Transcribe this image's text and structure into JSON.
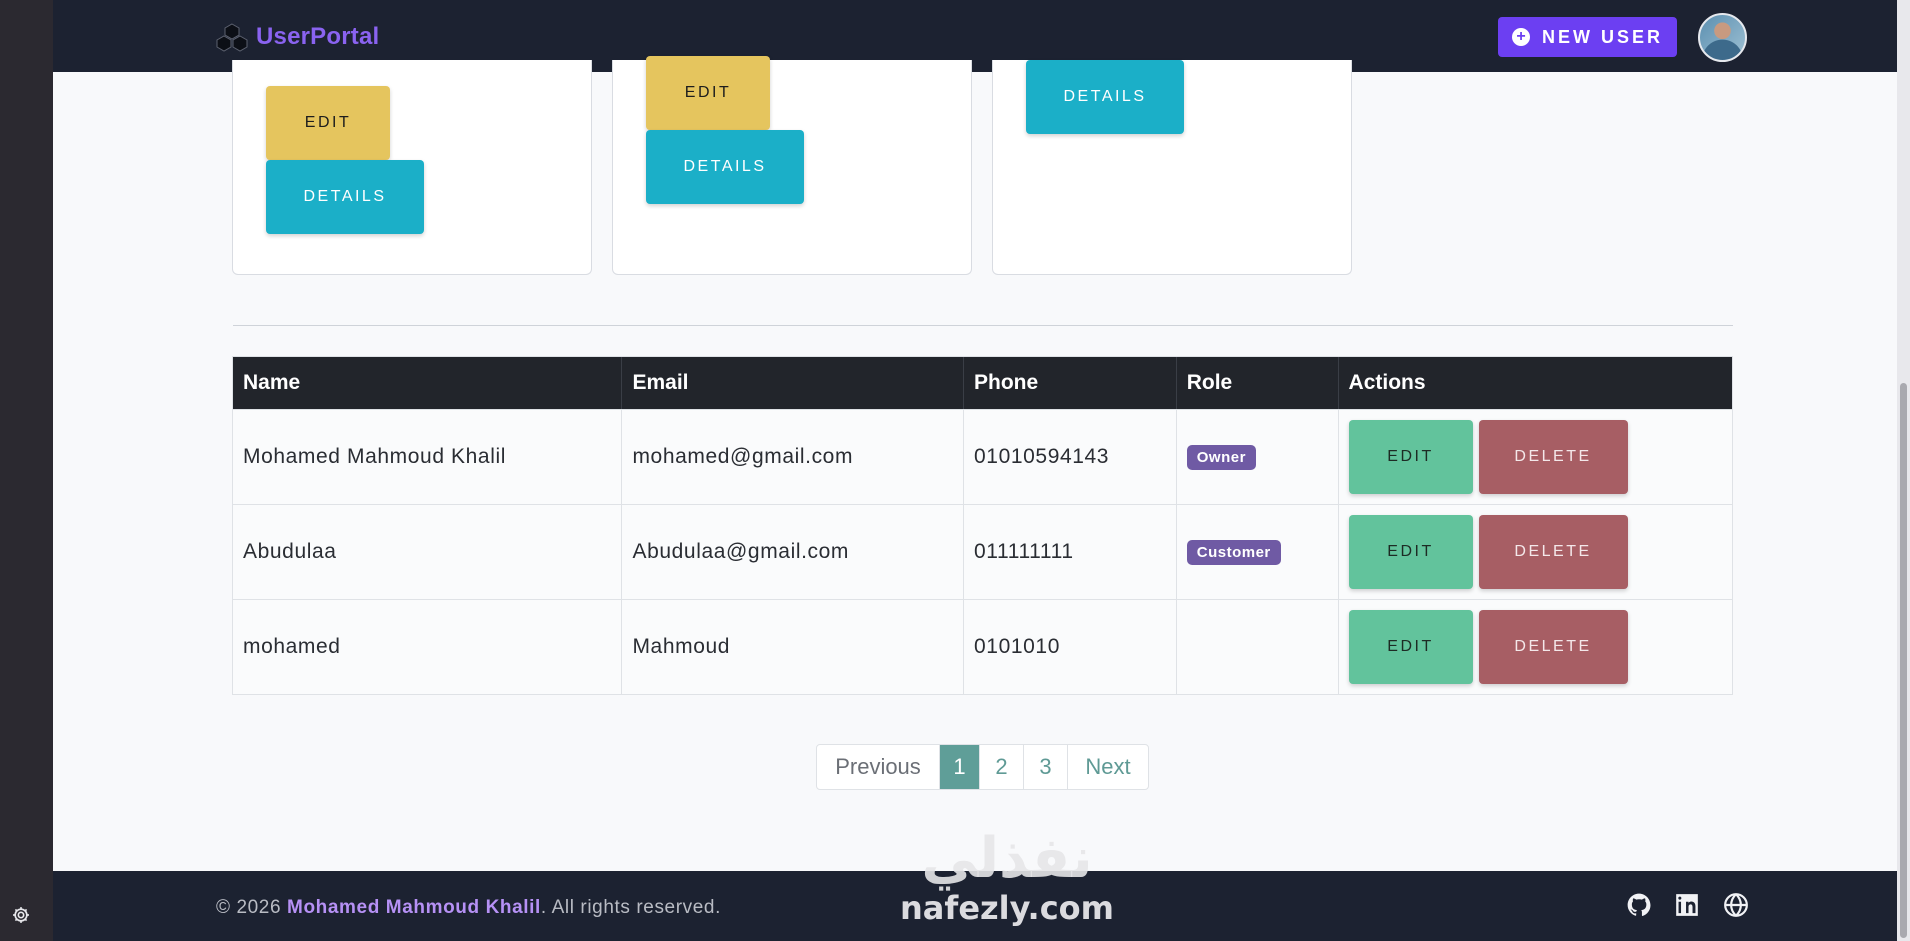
{
  "header": {
    "brand_name": "UserPortal",
    "new_user_label": "NEW USER",
    "brand_icon": "cubes-icon"
  },
  "cards": [
    {
      "edit_label": "EDIT",
      "details_label": "DETAILS"
    },
    {
      "edit_label": "EDIT",
      "details_label": "DETAILS"
    },
    {
      "details_label": "DETAILS"
    }
  ],
  "table": {
    "columns": [
      "Name",
      "Email",
      "Phone",
      "Role",
      "Actions"
    ],
    "rows": [
      {
        "name": "Mohamed Mahmoud Khalil",
        "email": "mohamed@gmail.com",
        "phone": "01010594143",
        "role": "Owner",
        "edit": "EDIT",
        "delete": "DELETE"
      },
      {
        "name": "Abudulaa",
        "email": "Abudulaa@gmail.com",
        "phone": "011111111",
        "role": "Customer",
        "edit": "EDIT",
        "delete": "DELETE"
      },
      {
        "name": "mohamed",
        "email": "Mahmoud",
        "phone": "0101010",
        "role": "",
        "edit": "EDIT",
        "delete": "DELETE"
      }
    ]
  },
  "pagination": {
    "previous": "Previous",
    "pages": [
      "1",
      "2",
      "3"
    ],
    "active_page": "1",
    "next": "Next"
  },
  "footer": {
    "prefix": "© 2026 ",
    "owner": "Mohamed Mahmoud Khalil",
    "suffix": ". All rights reserved.",
    "social_icons": [
      "github-icon",
      "linkedin-icon",
      "globe-icon"
    ]
  },
  "watermark": {
    "arabic": "نفذلي",
    "latin": "nafezly.com"
  },
  "colors": {
    "header_bg": "#1c2231",
    "brand": "#8a63f0",
    "new_user_button": "#6c3ff2",
    "edit_yellow": "#e5c55e",
    "details_cyan": "#1bafc8",
    "edit_green": "#62c39c",
    "delete_red": "#a75e64",
    "badge_purple": "#6f5aa4",
    "page_active": "#5f9e98"
  }
}
